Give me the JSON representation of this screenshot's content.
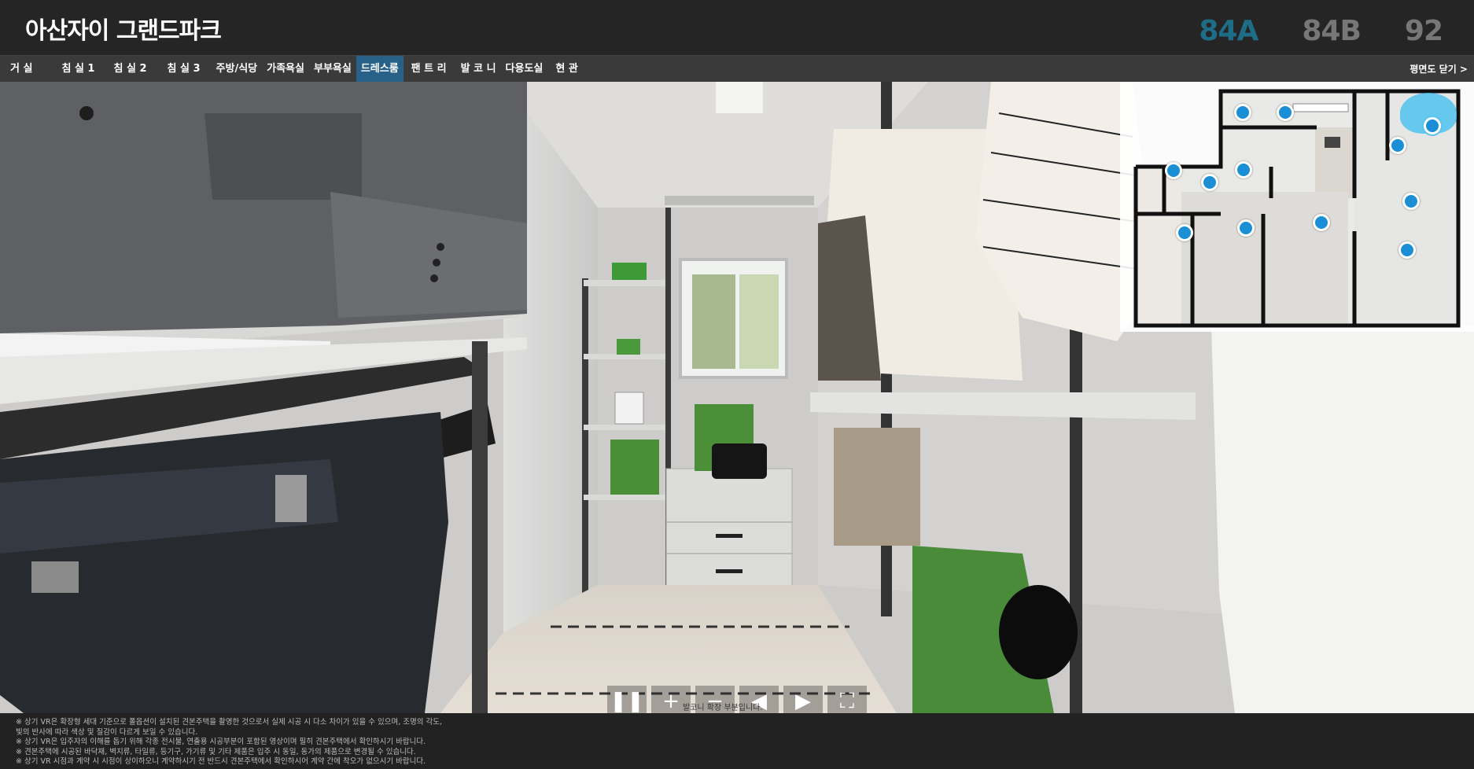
{
  "header": {
    "title": "아산자이 그랜드파크",
    "types": [
      {
        "label": "84A",
        "active": true
      },
      {
        "label": "84B",
        "active": false
      },
      {
        "label": "92",
        "active": false
      }
    ]
  },
  "nav": {
    "rooms": [
      {
        "label": "거 실"
      },
      {
        "label": "침 실 1"
      },
      {
        "label": "침 실 2"
      },
      {
        "label": "침 실 3"
      },
      {
        "label": "주방/식당"
      },
      {
        "label": "가족욕실"
      },
      {
        "label": "부부욕실"
      },
      {
        "label": "드레스룸",
        "active": true
      },
      {
        "label": "팬 트 리"
      },
      {
        "label": "발 코 니"
      },
      {
        "label": "다용도실"
      },
      {
        "label": "현 관"
      }
    ],
    "close_plan": "평면도 닫기 >"
  },
  "controls": {
    "caption": "발코니 확장 부분입니다.",
    "icons": [
      "pause-icon",
      "zoom-in-icon",
      "zoom-out-icon",
      "rotate-left-icon",
      "rotate-right-icon",
      "fullscreen-icon"
    ]
  },
  "disclaimer": [
    "※ 상기 VR은 확장형 세대 기준으로 폴옵션이 설치된 견본주택을 촬영한 것으로서 실제 시공 시 다소 차이가 있을 수 있으며, 조명의 각도,",
    "빛의 반사에 따라 색상 및 질감이 다르게 보일 수 있습니다.",
    "※ 상기 VR은 입주자의 이해를 돕기 위해 각종 전시물, 연출용 시공부분이 포함된 영상이며 필히 견본주택에서 확인하시기 바랍니다.",
    "※ 견본주택에 시공된 바닥재, 벽지류, 타일류, 등기구, 가기류 및 기타 제품은 입주 시 동일, 동가의 제품으로 변경될 수 있습니다.",
    "※ 상기 VR 시점과 계약 시 시점이 상이하오니 계약하시기 전 반드시 견본주택에서 확인하시어 계약 간에 착오가 없으시기 바랍니다."
  ],
  "colors": {
    "accent": "#1e6d86",
    "nav_active": "#27618a",
    "hotspot": "#1a8fd6"
  }
}
